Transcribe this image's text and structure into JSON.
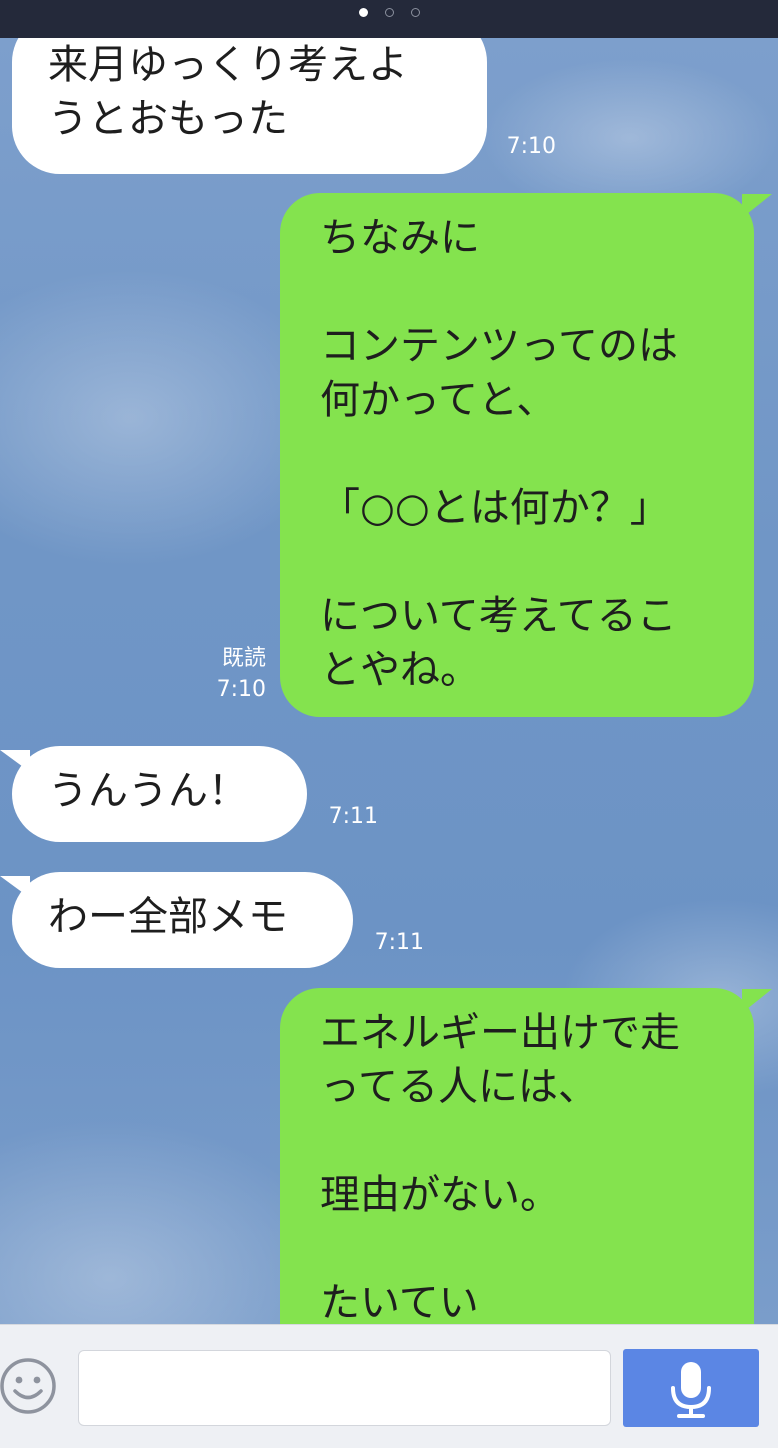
{
  "pager": {
    "pages": 3,
    "active_index": 0
  },
  "messages": [
    {
      "side": "in",
      "text": "来月ゆっくり考えよ\nうとおもった",
      "time": "7:10"
    },
    {
      "side": "out",
      "text": "ちなみに\n\nコンテンツってのは\n何かってと、\n\n「○○とは何か？」\n\nについて考えてるこ\nとやね。",
      "read_label": "既読",
      "time": "7:10"
    },
    {
      "side": "in",
      "text": "うんうん！",
      "time": "7:11"
    },
    {
      "side": "in",
      "text": "わー全部メモ",
      "time": "7:11"
    },
    {
      "side": "out",
      "text": "エネルギー出けで走\nってる人には、\n\n理由がない。\n\nたいてい"
    }
  ],
  "input": {
    "value": "",
    "emoji_icon": "smiley-icon",
    "mic_icon": "microphone-icon"
  },
  "colors": {
    "header": "#24293a",
    "chat_background": "#7096c6",
    "incoming_bubble": "#ffffff",
    "outgoing_bubble": "#84e34e",
    "mic_button": "#5b86e4"
  }
}
